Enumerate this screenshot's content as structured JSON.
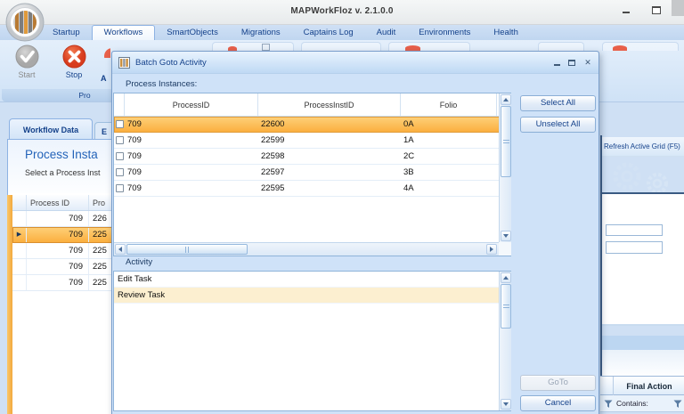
{
  "window": {
    "title": "MAPWorkFloz  v. 2.1.0.0"
  },
  "ribbon": {
    "tabs": [
      {
        "label": "Startup",
        "active": false
      },
      {
        "label": "Workflows",
        "active": true
      },
      {
        "label": "SmartObjects",
        "active": false
      },
      {
        "label": "Migrations",
        "active": false
      },
      {
        "label": "Captains Log",
        "active": false
      },
      {
        "label": "Audit",
        "active": false
      },
      {
        "label": "Environments",
        "active": false
      },
      {
        "label": "Health",
        "active": false
      }
    ],
    "start_button": "Start",
    "stop_button": "Stop",
    "group_label_partial": "Pro",
    "partial_button_letter": "A"
  },
  "workspace": {
    "tabs": [
      {
        "label": "Workflow Data",
        "active": true
      },
      {
        "label": "E",
        "active": false
      }
    ],
    "heading_partial": "Process Insta",
    "subheading_partial": "Select a Process Inst",
    "grid": {
      "columns": [
        "Process ID",
        "Pro"
      ],
      "rows": [
        {
          "process_id": "709",
          "col2": "226",
          "selected": false
        },
        {
          "process_id": "709",
          "col2": "225",
          "selected": true
        },
        {
          "process_id": "709",
          "col2": "225",
          "selected": false
        },
        {
          "process_id": "709",
          "col2": "225",
          "selected": false
        },
        {
          "process_id": "709",
          "col2": "225",
          "selected": false
        }
      ]
    },
    "right_panel": {
      "refresh_label": "Refresh Active Grid (F5)",
      "final_action_header": "Final Action",
      "contains_label": "Contains:"
    }
  },
  "dialog": {
    "title": "Batch Goto Activity",
    "process_instances_label": "Process Instances:",
    "instances_table": {
      "columns": [
        "ProcessID",
        "ProcessInstID",
        "Folio"
      ],
      "rows": [
        {
          "checked": false,
          "process_id": "709",
          "process_inst_id": "22600",
          "folio": "0A",
          "selected": true
        },
        {
          "checked": false,
          "process_id": "709",
          "process_inst_id": "22599",
          "folio": "1A",
          "selected": false
        },
        {
          "checked": false,
          "process_id": "709",
          "process_inst_id": "22598",
          "folio": "2C",
          "selected": false
        },
        {
          "checked": false,
          "process_id": "709",
          "process_inst_id": "22597",
          "folio": "3B",
          "selected": false
        },
        {
          "checked": false,
          "process_id": "709",
          "process_inst_id": "22595",
          "folio": "4A",
          "selected": false
        }
      ]
    },
    "activity_label": "Activity",
    "activities": [
      {
        "label": "Edit Task",
        "selected": false
      },
      {
        "label": "Review Task",
        "selected": true
      }
    ],
    "buttons": {
      "select_all": "Select All",
      "unselect_all": "Unselect All",
      "goto": "GoTo",
      "goto_enabled": false,
      "cancel": "Cancel"
    }
  },
  "colors": {
    "selection_orange": "#FBAF3F",
    "selection_cream": "#FCEFD0",
    "accent_blue": "#15428B",
    "stop_red": "#E2502F",
    "dialog_body": "#CFE2F8"
  }
}
